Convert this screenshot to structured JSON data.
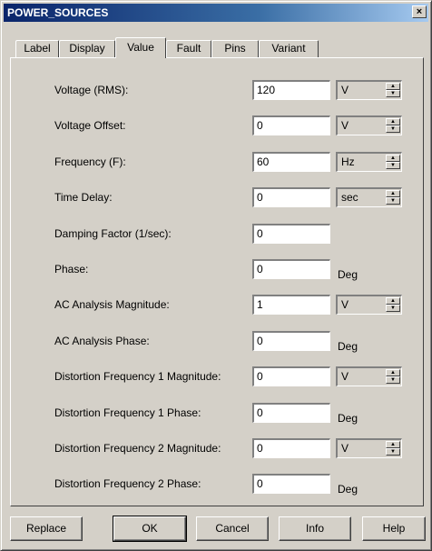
{
  "window": {
    "title": "POWER_SOURCES",
    "close_label": "×"
  },
  "tabs": [
    {
      "label": "Label"
    },
    {
      "label": "Display"
    },
    {
      "label": "Value"
    },
    {
      "label": "Fault"
    },
    {
      "label": "Pins"
    },
    {
      "label": "Variant"
    }
  ],
  "active_tab": "Value",
  "fields": [
    {
      "label": "Voltage (RMS):",
      "value": "120",
      "unit": "V",
      "unit_kind": "select"
    },
    {
      "label": "Voltage Offset:",
      "value": "0",
      "unit": "V",
      "unit_kind": "select"
    },
    {
      "label": "Frequency (F):",
      "value": "60",
      "unit": "Hz",
      "unit_kind": "select"
    },
    {
      "label": "Time Delay:",
      "value": "0",
      "unit": "sec",
      "unit_kind": "select"
    },
    {
      "label": "Damping Factor (1/sec):",
      "value": "0",
      "unit": "",
      "unit_kind": "none"
    },
    {
      "label": "Phase:",
      "value": "0",
      "unit": "Deg",
      "unit_kind": "text"
    },
    {
      "label": "AC Analysis Magnitude:",
      "value": "1",
      "unit": "V",
      "unit_kind": "select"
    },
    {
      "label": "AC Analysis Phase:",
      "value": "0",
      "unit": "Deg",
      "unit_kind": "text"
    },
    {
      "label": "Distortion Frequency 1 Magnitude:",
      "value": "0",
      "unit": "V",
      "unit_kind": "select"
    },
    {
      "label": "Distortion Frequency 1 Phase:",
      "value": "0",
      "unit": "Deg",
      "unit_kind": "text"
    },
    {
      "label": "Distortion Frequency 2 Magnitude:",
      "value": "0",
      "unit": "V",
      "unit_kind": "select"
    },
    {
      "label": "Distortion Frequency 2 Phase:",
      "value": "0",
      "unit": "Deg",
      "unit_kind": "text"
    }
  ],
  "buttons": {
    "replace": "Replace",
    "ok": "OK",
    "cancel": "Cancel",
    "info": "Info",
    "help": "Help"
  },
  "colors": {
    "titlebar_start": "#0a246a",
    "titlebar_end": "#a6caf0",
    "face": "#d4d0c8"
  }
}
